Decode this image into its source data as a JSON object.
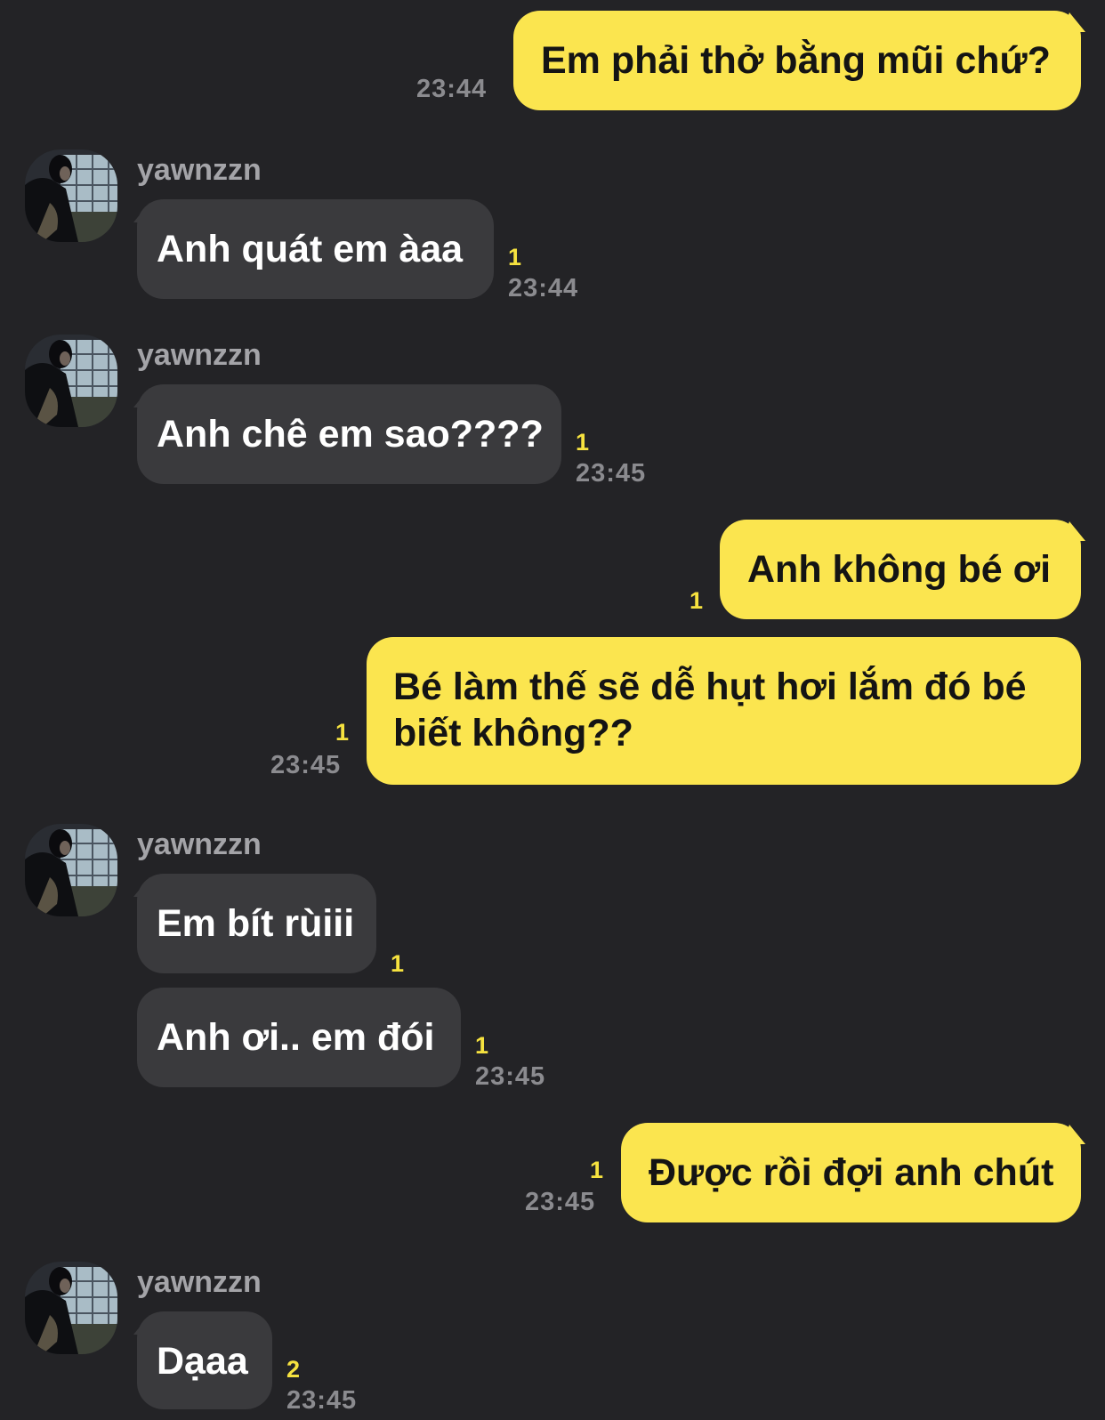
{
  "contact": {
    "name": "yawnzzn"
  },
  "messages": [
    {
      "side": "me",
      "text": "Em phải thở bằng mũi chứ?",
      "time": "23:44",
      "unread": ""
    },
    {
      "side": "them",
      "text": "Anh quát em àaa",
      "time": "23:44",
      "unread": "1"
    },
    {
      "side": "them",
      "text": "Anh chê em sao????",
      "time": "23:45",
      "unread": "1"
    },
    {
      "side": "me",
      "text": "Anh không bé ơi",
      "time": "",
      "unread": "1"
    },
    {
      "side": "me",
      "text": "Bé làm thế sẽ dễ hụt hơi lắm đó bé biết không??",
      "time": "23:45",
      "unread": "1"
    },
    {
      "side": "them",
      "text": "Em bít rùiii",
      "time": "",
      "unread": "1"
    },
    {
      "side": "them",
      "text": "Anh ơi.. em đói",
      "time": "23:45",
      "unread": "1"
    },
    {
      "side": "me",
      "text": "Được rồi đợi anh chút",
      "time": "23:45",
      "unread": "1"
    },
    {
      "side": "them",
      "text": "Dạaa",
      "time": "23:45",
      "unread": "2"
    }
  ],
  "colors": {
    "background": "#232326",
    "my_bubble": "#FBE54F",
    "their_bubble": "#3A3A3D",
    "unread_count": "#F6E23F",
    "timestamp": "#8B8B8F"
  },
  "icons": {
    "avatar": "avatar-photo-icon"
  }
}
